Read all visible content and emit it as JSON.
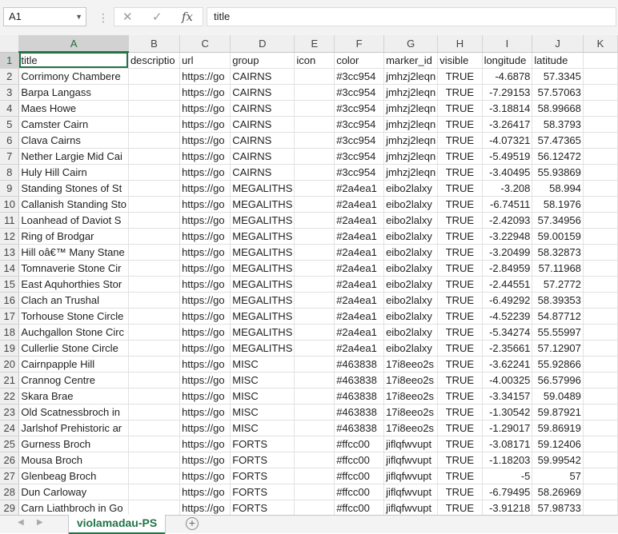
{
  "formula_bar": {
    "name_box": "A1",
    "formula": "title"
  },
  "icons": {
    "cancel": "cancel-icon",
    "enter": "enter-icon",
    "function": "fx-icon"
  },
  "columns": [
    "A",
    "B",
    "C",
    "D",
    "E",
    "F",
    "G",
    "H",
    "I",
    "J",
    "K"
  ],
  "rows": [
    {
      "n": "1",
      "cells": [
        "title",
        "descriptio",
        "url",
        "group",
        "icon",
        "color",
        "marker_id",
        "visible",
        "longitude",
        "latitude",
        ""
      ]
    },
    {
      "n": "2",
      "cells": [
        "Corrimony Chambere",
        "",
        "https://go",
        "CAIRNS",
        "",
        "#3cc954",
        "jmhzj2leqn",
        "TRUE",
        "-4.6878",
        "57.3345",
        ""
      ]
    },
    {
      "n": "3",
      "cells": [
        "Barpa Langass",
        "",
        "https://go",
        "CAIRNS",
        "",
        "#3cc954",
        "jmhzj2leqn",
        "TRUE",
        "-7.29153",
        "57.57063",
        ""
      ]
    },
    {
      "n": "4",
      "cells": [
        "Maes Howe",
        "",
        "https://go",
        "CAIRNS",
        "",
        "#3cc954",
        "jmhzj2leqn",
        "TRUE",
        "-3.18814",
        "58.99668",
        ""
      ]
    },
    {
      "n": "5",
      "cells": [
        "Camster Cairn",
        "",
        "https://go",
        "CAIRNS",
        "",
        "#3cc954",
        "jmhzj2leqn",
        "TRUE",
        "-3.26417",
        "58.3793",
        ""
      ]
    },
    {
      "n": "6",
      "cells": [
        "Clava Cairns",
        "",
        "https://go",
        "CAIRNS",
        "",
        "#3cc954",
        "jmhzj2leqn",
        "TRUE",
        "-4.07321",
        "57.47365",
        ""
      ]
    },
    {
      "n": "7",
      "cells": [
        "Nether Largie Mid Cai",
        "",
        "https://go",
        "CAIRNS",
        "",
        "#3cc954",
        "jmhzj2leqn",
        "TRUE",
        "-5.49519",
        "56.12472",
        ""
      ]
    },
    {
      "n": "8",
      "cells": [
        "Huly Hill Cairn",
        "",
        "https://go",
        "CAIRNS",
        "",
        "#3cc954",
        "jmhzj2leqn",
        "TRUE",
        "-3.40495",
        "55.93869",
        ""
      ]
    },
    {
      "n": "9",
      "cells": [
        "Standing Stones of St",
        "",
        "https://go",
        "MEGALITHS",
        "",
        "#2a4ea1",
        "eibo2lalxy",
        "TRUE",
        "-3.208",
        "58.994",
        ""
      ]
    },
    {
      "n": "10",
      "cells": [
        "Callanish Standing Sto",
        "",
        "https://go",
        "MEGALITHS",
        "",
        "#2a4ea1",
        "eibo2lalxy",
        "TRUE",
        "-6.74511",
        "58.1976",
        ""
      ]
    },
    {
      "n": "11",
      "cells": [
        "Loanhead of Daviot S",
        "",
        "https://go",
        "MEGALITHS",
        "",
        "#2a4ea1",
        "eibo2lalxy",
        "TRUE",
        "-2.42093",
        "57.34956",
        ""
      ]
    },
    {
      "n": "12",
      "cells": [
        "Ring of Brodgar",
        "",
        "https://go",
        "MEGALITHS",
        "",
        "#2a4ea1",
        "eibo2lalxy",
        "TRUE",
        "-3.22948",
        "59.00159",
        ""
      ]
    },
    {
      "n": "13",
      "cells": [
        "Hill oâ€™ Many Stane",
        "",
        "https://go",
        "MEGALITHS",
        "",
        "#2a4ea1",
        "eibo2lalxy",
        "TRUE",
        "-3.20499",
        "58.32873",
        ""
      ]
    },
    {
      "n": "14",
      "cells": [
        "Tomnaverie Stone Cir",
        "",
        "https://go",
        "MEGALITHS",
        "",
        "#2a4ea1",
        "eibo2lalxy",
        "TRUE",
        "-2.84959",
        "57.11968",
        ""
      ]
    },
    {
      "n": "15",
      "cells": [
        "East Aquhorthies Stor",
        "",
        "https://go",
        "MEGALITHS",
        "",
        "#2a4ea1",
        "eibo2lalxy",
        "TRUE",
        "-2.44551",
        "57.2772",
        ""
      ]
    },
    {
      "n": "16",
      "cells": [
        "Clach an Trushal",
        "",
        "https://go",
        "MEGALITHS",
        "",
        "#2a4ea1",
        "eibo2lalxy",
        "TRUE",
        "-6.49292",
        "58.39353",
        ""
      ]
    },
    {
      "n": "17",
      "cells": [
        "Torhouse Stone Circle",
        "",
        "https://go",
        "MEGALITHS",
        "",
        "#2a4ea1",
        "eibo2lalxy",
        "TRUE",
        "-4.52239",
        "54.87712",
        ""
      ]
    },
    {
      "n": "18",
      "cells": [
        "Auchgallon Stone Circ",
        "",
        "https://go",
        "MEGALITHS",
        "",
        "#2a4ea1",
        "eibo2lalxy",
        "TRUE",
        "-5.34274",
        "55.55997",
        ""
      ]
    },
    {
      "n": "19",
      "cells": [
        "Cullerlie Stone Circle",
        "",
        "https://go",
        "MEGALITHS",
        "",
        "#2a4ea1",
        "eibo2lalxy",
        "TRUE",
        "-2.35661",
        "57.12907",
        ""
      ]
    },
    {
      "n": "20",
      "cells": [
        "Cairnpapple Hill",
        "",
        "https://go",
        "MISC",
        "",
        "#463838",
        "17i8eeo2s",
        "TRUE",
        "-3.62241",
        "55.92866",
        ""
      ]
    },
    {
      "n": "21",
      "cells": [
        "Crannog Centre",
        "",
        "https://go",
        "MISC",
        "",
        "#463838",
        "17i8eeo2s",
        "TRUE",
        "-4.00325",
        "56.57996",
        ""
      ]
    },
    {
      "n": "22",
      "cells": [
        "Skara Brae",
        "",
        "https://go",
        "MISC",
        "",
        "#463838",
        "17i8eeo2s",
        "TRUE",
        "-3.34157",
        "59.0489",
        ""
      ]
    },
    {
      "n": "23",
      "cells": [
        "Old Scatnessbroch in",
        "",
        "https://go",
        "MISC",
        "",
        "#463838",
        "17i8eeo2s",
        "TRUE",
        "-1.30542",
        "59.87921",
        ""
      ]
    },
    {
      "n": "24",
      "cells": [
        "Jarlshof Prehistoric ar",
        "",
        "https://go",
        "MISC",
        "",
        "#463838",
        "17i8eeo2s",
        "TRUE",
        "-1.29017",
        "59.86919",
        ""
      ]
    },
    {
      "n": "25",
      "cells": [
        "Gurness Broch",
        "",
        "https://go",
        "FORTS",
        "",
        "#ffcc00",
        "jiflqfwvupt",
        "TRUE",
        "-3.08171",
        "59.12406",
        ""
      ]
    },
    {
      "n": "26",
      "cells": [
        "Mousa Broch",
        "",
        "https://go",
        "FORTS",
        "",
        "#ffcc00",
        "jiflqfwvupt",
        "TRUE",
        "-1.18203",
        "59.99542",
        ""
      ]
    },
    {
      "n": "27",
      "cells": [
        "Glenbeag Broch",
        "",
        "https://go",
        "FORTS",
        "",
        "#ffcc00",
        "jiflqfwvupt",
        "TRUE",
        "-5",
        "57",
        ""
      ]
    },
    {
      "n": "28",
      "cells": [
        "Dun Carloway",
        "",
        "https://go",
        "FORTS",
        "",
        "#ffcc00",
        "jiflqfwvupt",
        "TRUE",
        "-6.79495",
        "58.26969",
        ""
      ]
    },
    {
      "n": "29",
      "cells": [
        "Carn Liathbroch in Go",
        "",
        "https://go",
        "FORTS",
        "",
        "#ffcc00",
        "jiflqfwvupt",
        "TRUE",
        "-3.91218",
        "57.98733",
        ""
      ]
    }
  ],
  "sheet_tabs": {
    "active": "violamadau-PS",
    "prev_icon": "triangle-left-icon",
    "next_icon": "triangle-right-icon",
    "add_icon": "plus-circle-icon"
  },
  "colors": {
    "accent": "#217346"
  }
}
